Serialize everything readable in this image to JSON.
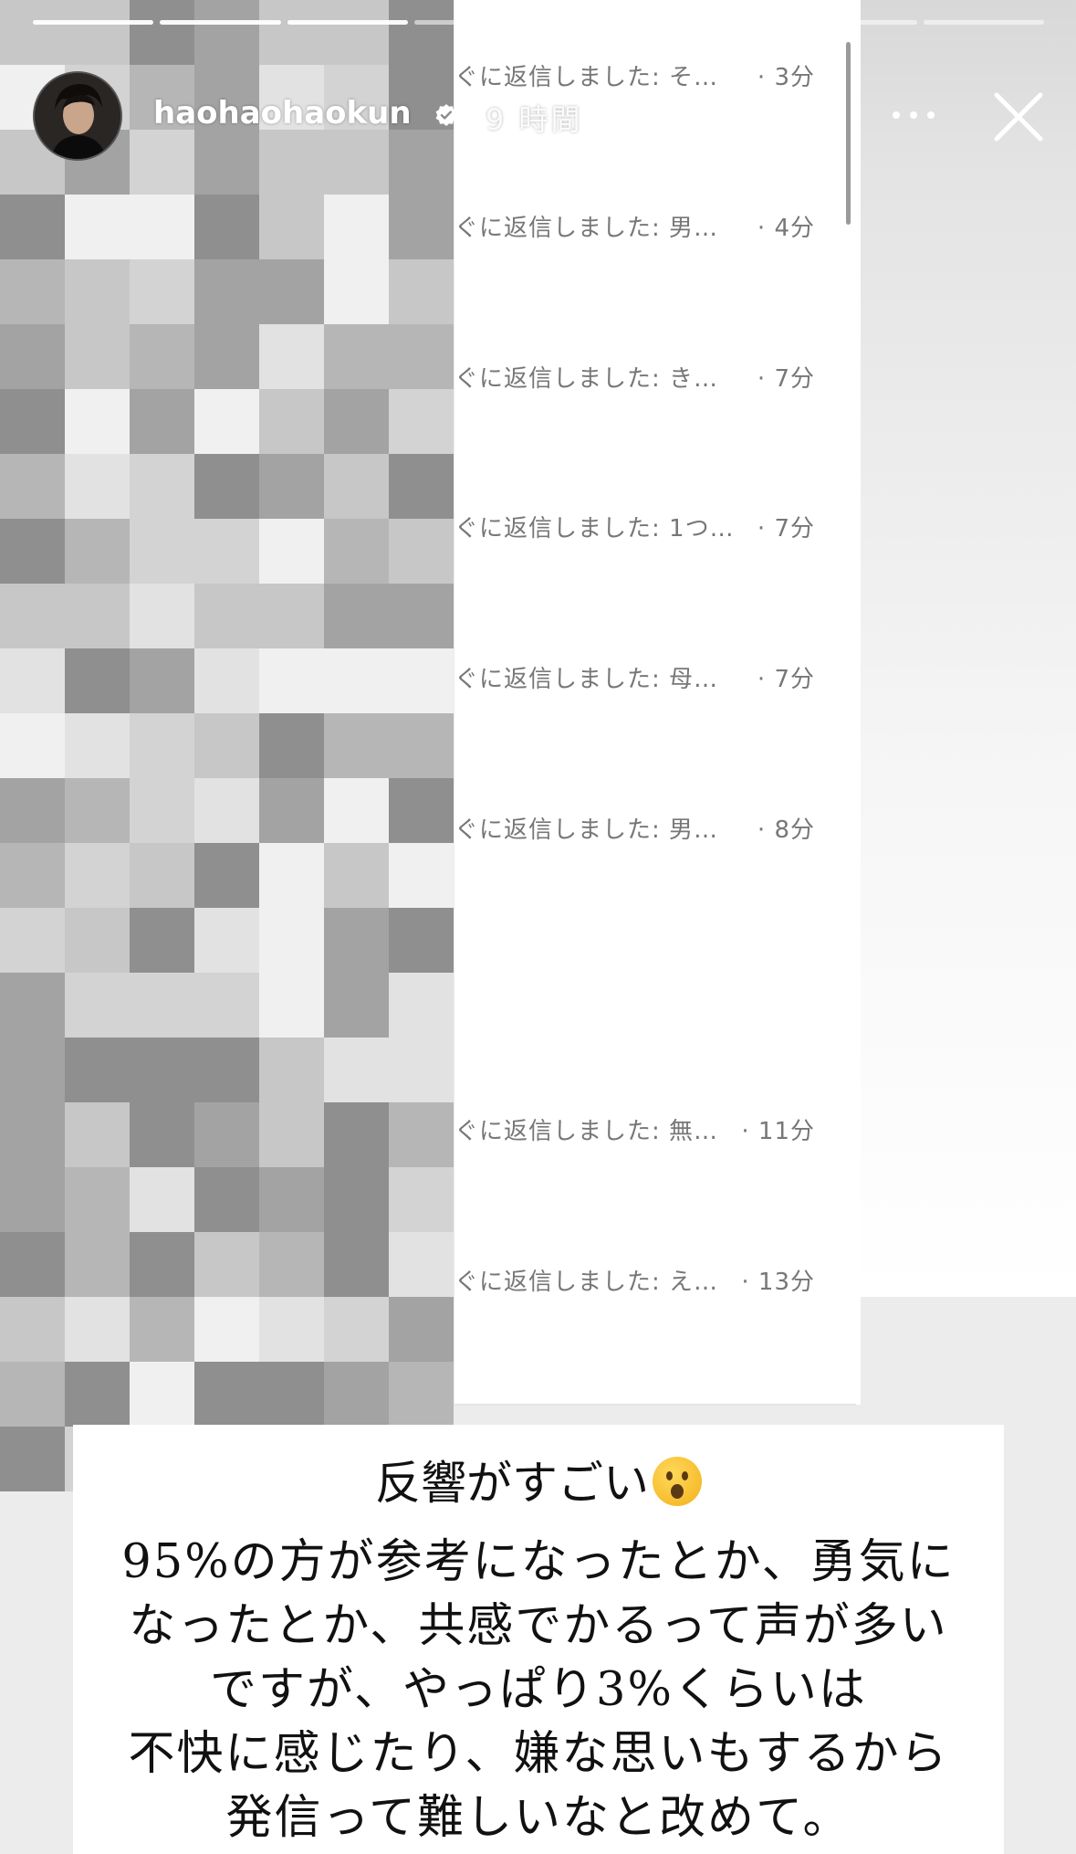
{
  "story": {
    "username": "haohaohaokun",
    "posted_time": "9 時間",
    "progress_segments": 8,
    "completed_segments": 3
  },
  "icons": {
    "verified": "verified-badge-icon",
    "more": "more-options-icon",
    "close": "close-icon"
  },
  "replies": [
    {
      "text": "ぐに返信しました: そ…",
      "time": "· 3分"
    },
    {
      "text": "ぐに返信しました: 男…",
      "time": "· 4分"
    },
    {
      "text": "ぐに返信しました: き…",
      "time": "· 7分"
    },
    {
      "text": "ぐに返信しました: 1つ…",
      "time": "· 7分"
    },
    {
      "text": "ぐに返信しました: 母…",
      "time": "· 7分"
    },
    {
      "text": "ぐに返信しました: 男…",
      "time": "· 8分"
    },
    {
      "text": "ぐに返信しました: 無…",
      "time": "· 11分"
    },
    {
      "text": "ぐに返信しました: え…",
      "time": "· 13分"
    }
  ],
  "caption": {
    "title": "反響がすごい",
    "lines": [
      "95%の方が参考になったとか、勇気に",
      "なったとか、共感でかるって声が多い",
      "ですが、やっぱり3%くらいは",
      "不快に感じたり、嫌な思いもするから",
      "発信って難しいなと改めて。"
    ]
  },
  "colors": {
    "caption_bg": "#ffffff",
    "reply_text": "#777777",
    "mosaic_shades": [
      "#8f8f8f",
      "#a3a3a3",
      "#b6b6b6",
      "#c7c7c7",
      "#d3d3d3",
      "#e2e2e2",
      "#f0f0f0"
    ]
  }
}
